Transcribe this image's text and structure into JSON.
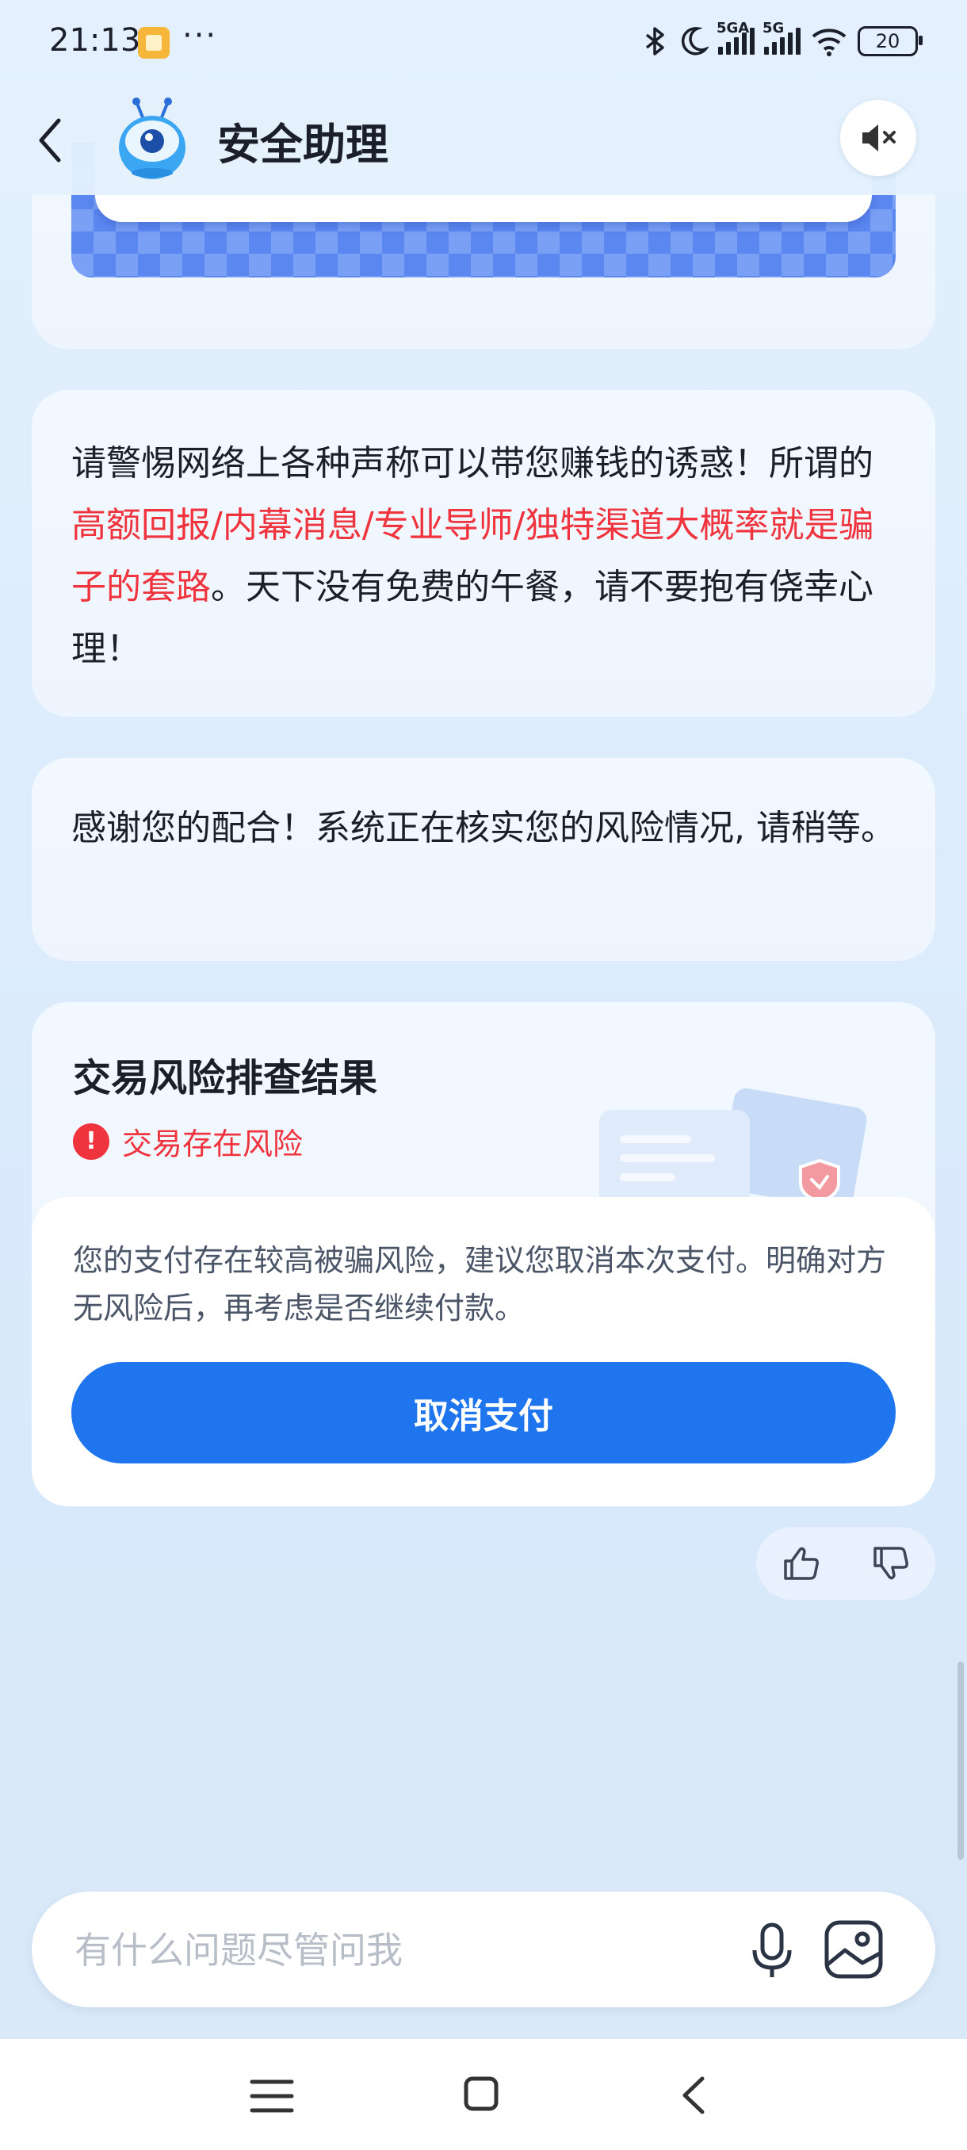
{
  "status_bar": {
    "time": "21:13",
    "more": "···",
    "net1": "5GA",
    "net2": "5G",
    "battery": "20"
  },
  "header": {
    "title": "安全助理",
    "back_icon": "chevron-left-icon",
    "mute_icon": "speaker-mute-icon"
  },
  "messages": {
    "warning": {
      "prefix": "请警惕网络上各种声称可以带您赚钱的诱惑！所谓的",
      "highlight": "高额回报/内幕消息/专业导师/独特渠道大概率就是骗子的套路",
      "suffix": "。天下没有免费的午餐，请不要抱有侥幸心理！"
    },
    "thanks": "感谢您的配合！系统正在核实您的风险情况, 请稍等。"
  },
  "result": {
    "title": "交易风险排查结果",
    "status": "交易存在风险",
    "description": "您的支付存在较高被骗风险，建议您取消本次支付。明确对方无风险后，再考虑是否继续付款。",
    "cancel_label": "取消支付"
  },
  "input": {
    "placeholder": "有什么问题尽管问我"
  },
  "colors": {
    "accent": "#1f75ee",
    "danger": "#f0343e"
  }
}
